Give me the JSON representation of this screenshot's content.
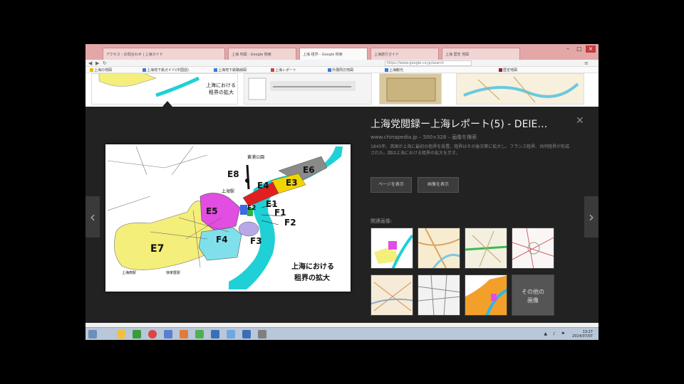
{
  "browser": {
    "tabs": [
      {
        "label": "アクセス・お問合わせ | 上海ガイド"
      },
      {
        "label": "上海 地図 - Google 検索"
      },
      {
        "label": "上海 租界 - Google 検索"
      },
      {
        "label": "上海旅行ガイド"
      },
      {
        "label": "上海 歴史 地図"
      }
    ],
    "address": "https://www.google.co.jp/search",
    "bookmarks": [
      {
        "label": "上海の地図"
      },
      {
        "label": "上海地下鉄ガイド(中国語)"
      },
      {
        "label": "上海地下鉄路線図"
      },
      {
        "label": "上海レポート"
      },
      {
        "label": "外灘周辺地図"
      },
      {
        "label": "上海観光"
      },
      {
        "label": "歴史地図"
      }
    ],
    "window_controls": {
      "min": "–",
      "max": "□",
      "close": "×"
    }
  },
  "strip": {
    "thumb1_label": "上海における\n租界の拡大"
  },
  "panel": {
    "title": "上海党閲録ー上海レポート(5) - DEIE…",
    "close_glyph": "✕",
    "meta": "www.chinapedia.jp – 500×328 – 画像を検索",
    "description": "1845年、英国が上海に最初の租界を設置。租界はその後次第に拡大し、フランス租界、共同租界が形成された。図は上海における租界の拡大を示す。",
    "buttons": {
      "visit_label": "ページを表示",
      "view_label": "画像を表示"
    },
    "related_label": "関連画像:",
    "more_label": "その他の\n画像",
    "prev_glyph": "‹",
    "next_glyph": "›"
  },
  "map": {
    "zones": [
      {
        "label": "E1"
      },
      {
        "label": "E2"
      },
      {
        "label": "E3"
      },
      {
        "label": "E4"
      },
      {
        "label": "E5"
      },
      {
        "label": "E6"
      },
      {
        "label": "E7"
      },
      {
        "label": "E8"
      },
      {
        "label": "F1"
      },
      {
        "label": "F2"
      },
      {
        "label": "F3"
      },
      {
        "label": "F4"
      }
    ],
    "caption_line1": "上海における",
    "caption_line2": "租界の拡大",
    "place_labels": {
      "park": "黄浦公園",
      "station": "上海駅",
      "fort": "上海南駅",
      "west": "徐家匯駅"
    },
    "colors": {
      "yellow": "#f4ee7a",
      "magenta": "#e24de2",
      "cyan": "#7fe0ec",
      "red": "#e02020",
      "gold": "#f2d400",
      "gray": "#8a8a8a",
      "river": "#1fd0d6",
      "purple": "#b8a8e8"
    }
  },
  "taskbar": {
    "clock_time": "13:27",
    "clock_date": "2014/07/07",
    "tray": "▲ ♪ ⚑"
  }
}
